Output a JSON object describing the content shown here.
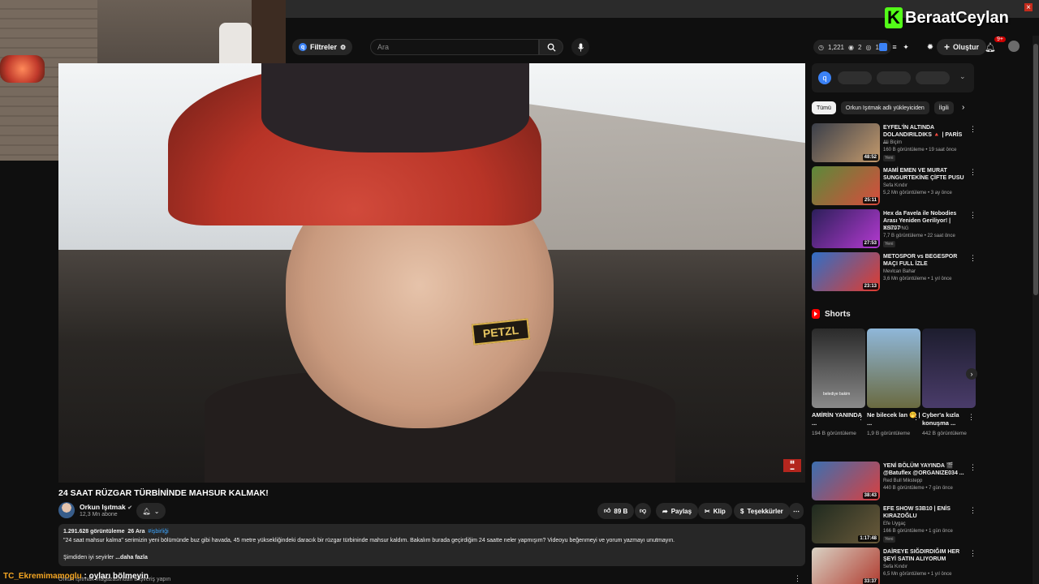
{
  "header": {
    "filters_label": "Filtreler",
    "search_placeholder": "Ara",
    "stats": [
      "1,221",
      "2",
      "153"
    ],
    "create_label": "Oluştur",
    "notif_count": "9+"
  },
  "overlay": {
    "logo_letter": "K",
    "logo_name": "BeraatCeylan",
    "chat_user": "TC_Ekremimamoglu",
    "chat_message": ": oyları bölmeyin"
  },
  "video": {
    "title": "24 SAAT RÜZGAR TÜRBİNİNDE MAHSUR KALMAK!",
    "strap_text": "PETZL",
    "channel_name": "Orkun Işıtmak",
    "subscribers": "12,3 Mn abone",
    "likes": "89 B",
    "share_label": "Paylaş",
    "clip_label": "Klip",
    "thanks_label": "Teşekkürler",
    "views": "1.291.628 görüntüleme",
    "date": "26 Ara",
    "hashtag": "#işbirliği",
    "description": "\"24 saat mahsur kalma\" serimizin yeni bölümünde buz gibi havada, 45 metre yüksekliğindeki daracık bir rüzgar türbininde mahsur kaldım. Bakalım burada geçirdiğim 24 saatte neler yapmışım? Videoyu beğenmeyi ve yorum yazmayı unutmayın.",
    "more_prefix": "Şimdiden iyi seyirler",
    "more_label": "...daha fazla",
    "store_line": "Orkun Işıtmak mağazasından alışveriş yapın"
  },
  "sidebar": {
    "chips": [
      "Tümü",
      "Orkun Işıtmak adlı yükleyiciden",
      "İlgili"
    ],
    "recs_top": [
      {
        "title": "EYFEL'İN ALTINDA DOLANDIRILDIKS 🔺 | PARİS ...",
        "channel": "Ali Biçim",
        "meta": "160 B görüntüleme • 19 saat önce",
        "badge": "Yeni",
        "duration": "48:52",
        "colors": [
          "#3a3f4a",
          "#c49a6c"
        ]
      },
      {
        "title": "MAMİ EMEN VE MURAT SUNGURTEKİNE ÇİFTE PUSU",
        "channel": "Sefa Kındır",
        "meta": "5,2 Mn görüntüleme • 3 ay önce",
        "badge": "",
        "duration": "25:11",
        "colors": [
          "#5b8a3a",
          "#d94b3c"
        ]
      },
      {
        "title": "Hex da Favela ile Nobodies Arası Yeniden Geriliyor! | XS707",
        "channel": "DDRP PNG",
        "meta": "7,7 B görüntüleme • 22 saat önce",
        "badge": "Yeni",
        "duration": "27:53",
        "colors": [
          "#2c1f5a",
          "#b43ad1"
        ]
      },
      {
        "title": "METOSPOR vs BEGESPOR MAÇI FULL İZLE",
        "channel": "Mevlcan Bahar",
        "meta": "3,6 Mn görüntüleme • 1 yıl önce",
        "badge": "",
        "duration": "23:13",
        "colors": [
          "#2f6fc7",
          "#e23b2e"
        ]
      }
    ],
    "shorts_heading": "Shorts",
    "shorts": [
      {
        "title": "AMİRİN YANINDA ...",
        "views": "194 B görüntüleme",
        "colors": [
          "#2a2a2a",
          "#8a8a8a"
        ]
      },
      {
        "title": "Ne bilecek lan 🤭 | ...",
        "views": "1,9 B görüntüleme",
        "colors": [
          "#8fb7d9",
          "#6a6a40"
        ]
      },
      {
        "title": "Cyber'a kızla konuşma ...",
        "views": "442 B görüntüleme",
        "colors": [
          "#1d1d2e",
          "#4a3c6a"
        ]
      }
    ],
    "recs_bottom": [
      {
        "title": "YENİ BÖLÜM YAYINDA 🎬 @Batuflex @ORGANIZE034 ...",
        "channel": "Red Bull Mikstepp",
        "meta": "440 B görüntüleme • 7 gün önce",
        "badge": "",
        "duration": "38:43",
        "colors": [
          "#3c6fb0",
          "#d94040"
        ]
      },
      {
        "title": "EFE SHOW S3B10 | ENİS KIRAZOĞLU",
        "channel": "Efe Uygaç",
        "meta": "166 B görüntüleme • 1 gün önce",
        "badge": "Yeni",
        "duration": "1:17:48",
        "colors": [
          "#1f2a1f",
          "#6a5a3a"
        ]
      },
      {
        "title": "DAİREYE SIĞDIRDIĞIM HER ŞEYİ SATIN ALIYORUM",
        "channel": "Sefa Kındır",
        "meta": "6,5 Mn görüntüleme • 1 yıl önce",
        "badge": "",
        "duration": "33:37",
        "colors": [
          "#d9d2c4",
          "#b03a2e"
        ]
      }
    ],
    "shorts_thumb_text": "belediye bakim"
  }
}
